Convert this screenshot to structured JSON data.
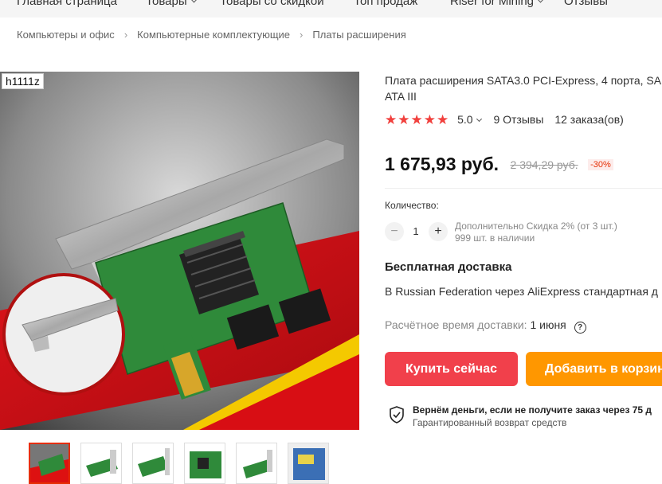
{
  "nav": {
    "items": [
      {
        "label": "Главная страница",
        "has_dropdown": false
      },
      {
        "label": "Товары",
        "has_dropdown": true
      },
      {
        "label": "Товары со скидкой",
        "has_dropdown": false
      },
      {
        "label": "Топ продаж",
        "has_dropdown": false
      },
      {
        "label": "Riser for Mining",
        "has_dropdown": true
      },
      {
        "label": "Отзывы",
        "has_dropdown": false
      }
    ]
  },
  "breadcrumb": [
    "Компьютеры и офис",
    "Компьютерные комплектующие",
    "Платы расширения"
  ],
  "gallery": {
    "store_badge": "h1111z",
    "thumbnail_count": 6,
    "active_thumbnail": 1
  },
  "product": {
    "title_line1": "Плата расширения SATA3.0 PCI-Express, 4 порта, SA",
    "title_line2": "ATA III",
    "rating_value": "5.0",
    "stars": 5,
    "reviews": "9 Отзывы",
    "orders": "12 заказа(ов)",
    "price": "1 675,93 руб.",
    "old_price": "2 394,29 руб.",
    "discount": "-30%"
  },
  "quantity": {
    "label": "Количество:",
    "minus": "−",
    "value": "1",
    "plus": "+",
    "extra_discount": "Дополнительно Скидка 2% (от 3 шт.)",
    "stock": "999 шт. в наличии"
  },
  "shipping": {
    "title": "Бесплатная доставка",
    "via": "В Russian Federation через AliExpress стандартная д",
    "estimate_label": "Расчётное время доставки:",
    "estimate_date": "1 июня",
    "help_icon": "?"
  },
  "actions": {
    "buy_now": "Купить сейчас",
    "add_to_cart": "Добавить в корзин"
  },
  "guarantee": {
    "title": "Вернём деньги, если не получите заказ через 75 д",
    "subtitle": "Гарантированный возврат средств"
  },
  "colors": {
    "accent_red": "#f1404b",
    "accent_orange": "#ff9700",
    "star_red": "#f1403d"
  }
}
